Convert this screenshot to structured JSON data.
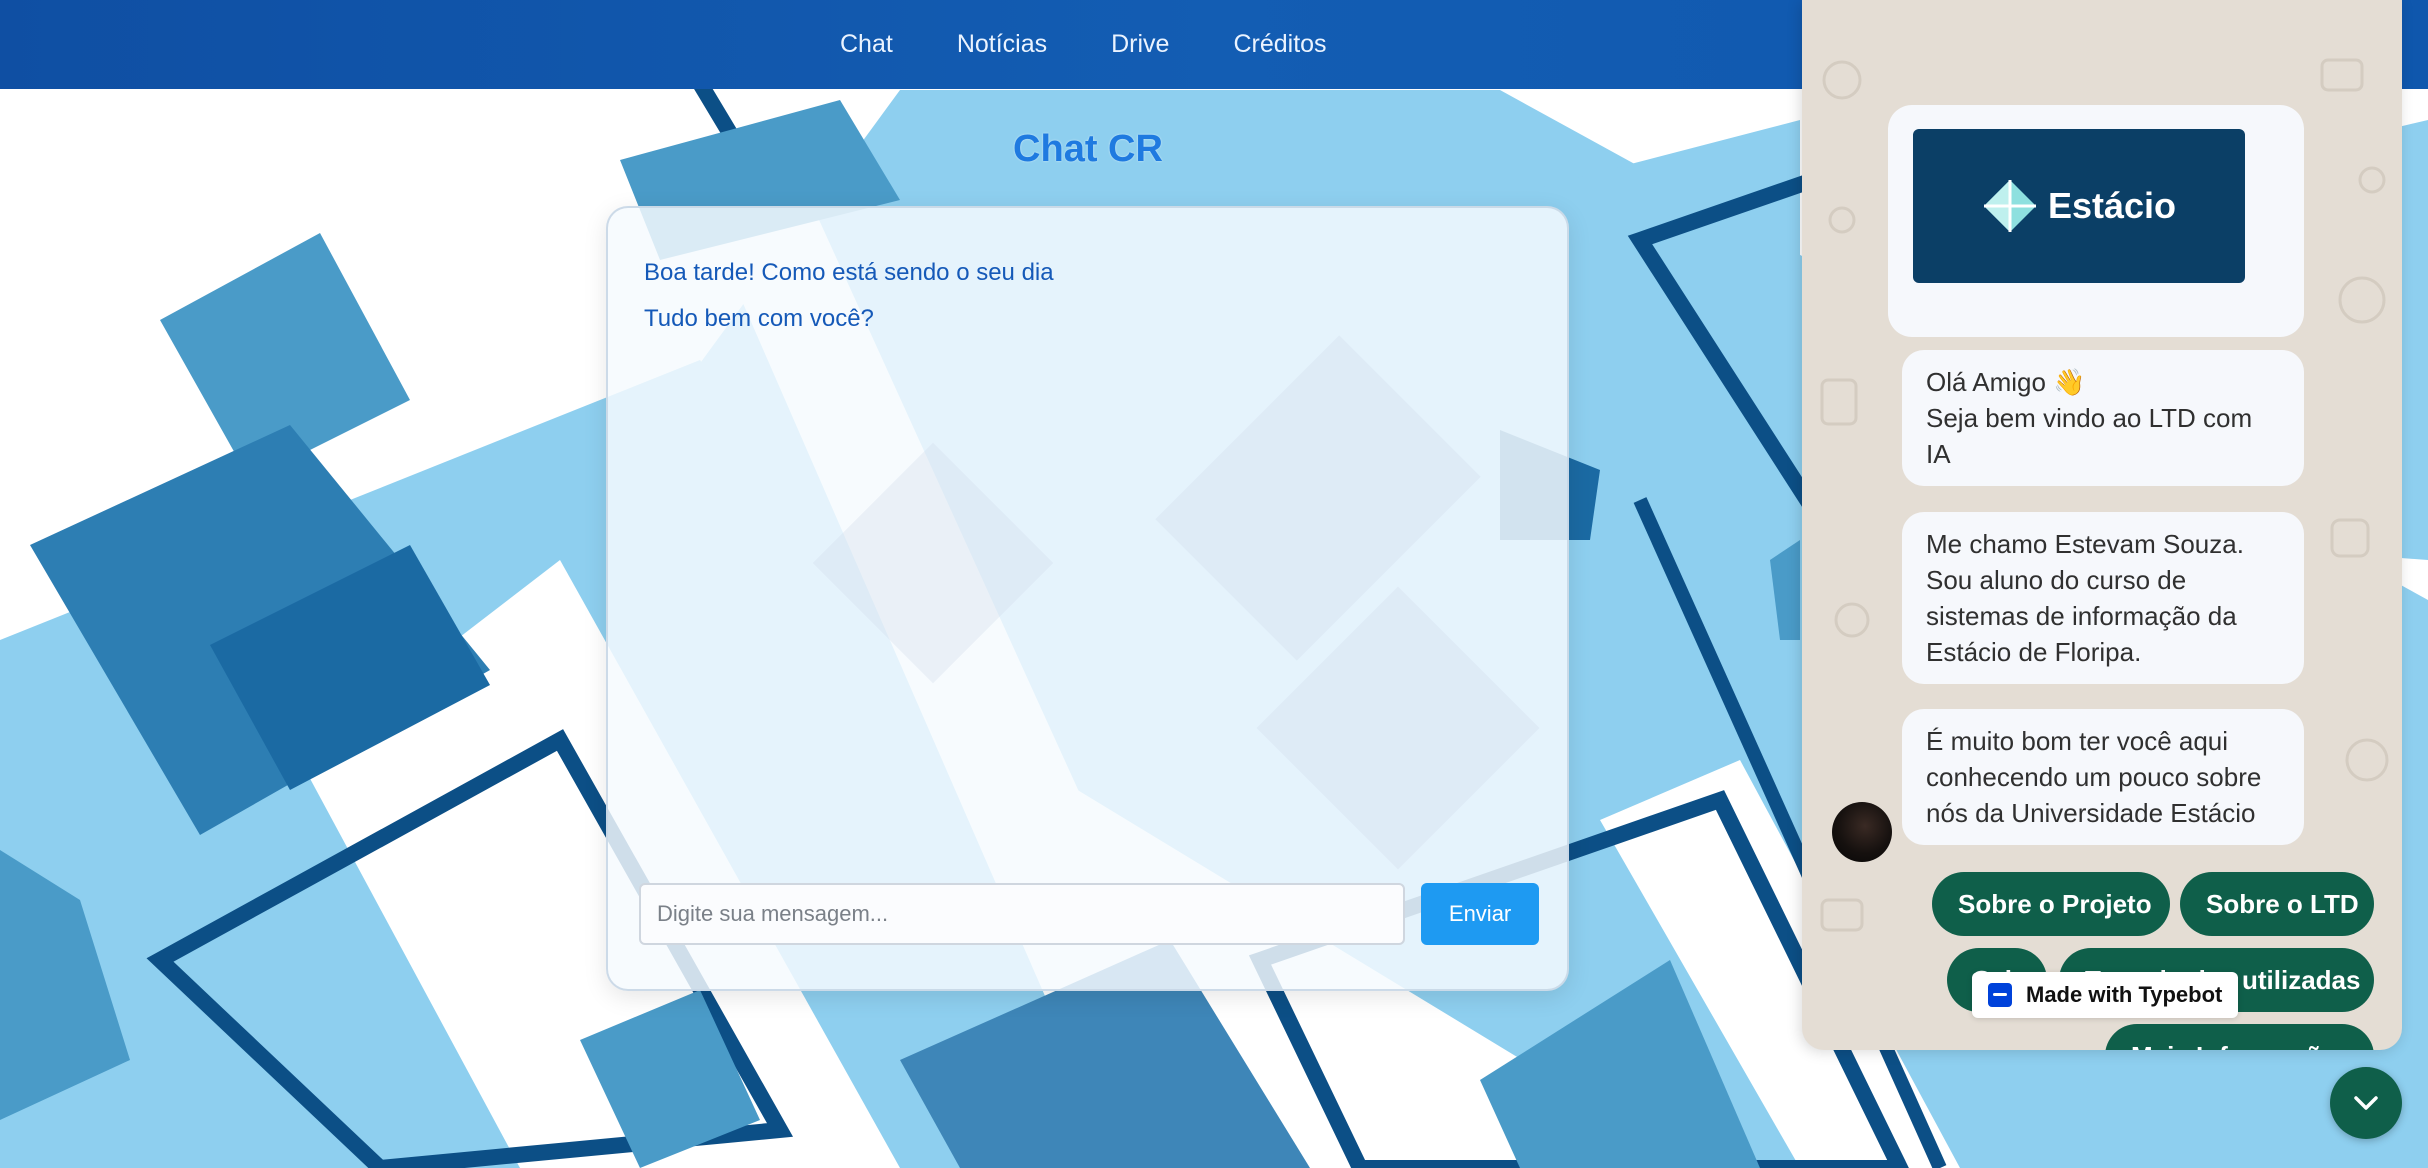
{
  "nav": {
    "items": [
      "Chat",
      "Notícias",
      "Drive",
      "Créditos"
    ]
  },
  "page_title": "Chat CR",
  "chat": {
    "messages": [
      "Boa tarde! Como está sendo o seu dia",
      "Tudo bem com você?"
    ],
    "input_placeholder": "Digite sua mensagem...",
    "send_label": "Enviar"
  },
  "bot": {
    "logo_text": "Estácio",
    "bubbles": [
      "Olá Amigo 👋\nSeja bem vindo ao LTD com IA",
      "Me chamo Estevam Souza. Sou aluno do curso de sistemas de informação da Estácio de Floripa.",
      "É muito bom ter você aqui conhecendo um pouco sobre nós da Universidade Estácio"
    ],
    "choices": [
      "Sobre o Projeto",
      "Sobre o LTD",
      "Sair",
      "Tecnologias utilizadas",
      "Mais Informações"
    ],
    "badge": "Made with Typebot"
  },
  "colors": {
    "nav_bg": "#135db3",
    "accent": "#1e9af2",
    "bot_button": "#0f5f4a",
    "bot_bg": "#e4ddd4"
  }
}
